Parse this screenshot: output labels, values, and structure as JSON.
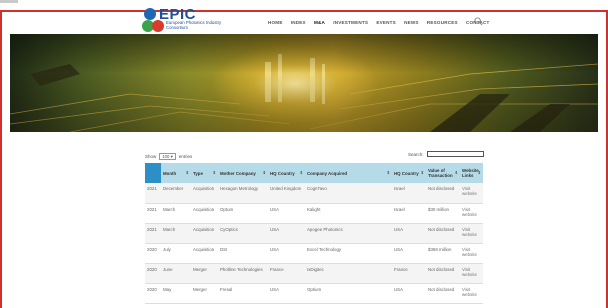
{
  "header": {
    "logo_word": "EPIC",
    "logo_subtitle": "European Photonics Industry Consortium",
    "nav": [
      "HOME",
      "INDEX",
      "M&A",
      "INVESTMENTS",
      "EVENTS",
      "NEWS",
      "RESOURCES",
      "CONTACT"
    ],
    "active_nav": "M&A"
  },
  "controls": {
    "show_label": "Show",
    "entries_value": "100",
    "entries_label": "entries",
    "search_label": "Search:"
  },
  "table": {
    "columns": [
      "",
      "Month",
      "Type",
      "Mother Company",
      "HQ Country",
      "Company Acquired",
      "HQ Country",
      "Value of Transaction",
      "Website Links"
    ],
    "rows": [
      [
        "2021",
        "December",
        "Acquisition",
        "Hexagon Metrology",
        "United Kingdom",
        "CognTavo",
        "Israel",
        "Not disclosed",
        "Visit website"
      ],
      [
        "2021",
        "March",
        "Acquisition",
        "Optum",
        "USA",
        "Kalight",
        "Israel",
        "$30 million",
        "Visit website"
      ],
      [
        "2021",
        "March",
        "Acquisition",
        "CyOptics",
        "USA",
        "Apogee Photonics",
        "USA",
        "Not disclosed",
        "Visit website"
      ],
      [
        "2020",
        "July",
        "Acquisition",
        "DSI",
        "USA",
        "Excel Technology",
        "USA",
        "$368 million",
        "Visit website"
      ],
      [
        "2020",
        "June",
        "Merger",
        "Photline Technologies",
        "France",
        "IxDigitec",
        "France",
        "Not disclosed",
        "Visit website"
      ],
      [
        "2020",
        "May",
        "Merger",
        "Fresal",
        "USA",
        "Optium",
        "USA",
        "Not disclosed",
        "Visit website"
      ]
    ]
  }
}
